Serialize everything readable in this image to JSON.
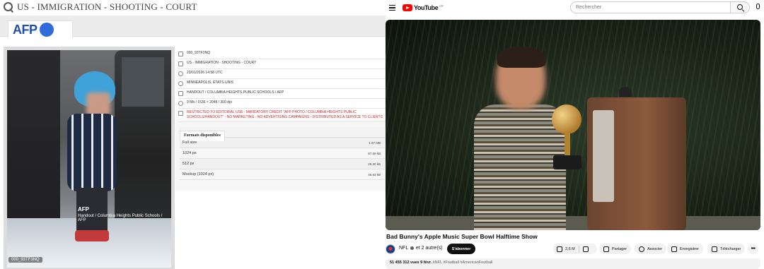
{
  "afp": {
    "search_query": "US - IMMIGRATION - SHOOTING - COURT",
    "logo_text": "AFP",
    "photo": {
      "watermark_logo": "AFP",
      "watermark_credit": "Handout / Columbia Heights Public Schools / AFP",
      "id_label": "000_93TF3NQ"
    },
    "metadata": [
      {
        "icon": "file-icon",
        "text": "000_93TF3NQ"
      },
      {
        "icon": "caption-icon",
        "text": "US - IMMIGRATION - SHOOTING - COURT"
      },
      {
        "icon": "clock-icon",
        "text": "23/01/2026 14:58 UTC"
      },
      {
        "icon": "globe-icon",
        "text": "MINNEAPOLIS, ÉTATS-UNIS"
      },
      {
        "icon": "credit-icon",
        "text": "HANDOUT / COLUMBIA HEIGHTS PUBLIC SCHOOLS / AFP"
      },
      {
        "icon": "size-icon",
        "text": "9 Mb / 1536 × 2048 / 300 dpi"
      },
      {
        "icon": "warning-icon",
        "text": "RESTRICTED TO EDITORIAL USE - MANDATORY CREDIT \"AFP PHOTO / COLUMBIA HEIGHTS PUBLIC SCHOOLS/HANDOUT\" - NO MARKETING - NO ADVERTISING CAMPAIGNS - DISTRIBUTED AS A SERVICE TO CLIENTS"
      }
    ],
    "formats_tab": "Formats disponibles",
    "formats": [
      {
        "name": "Full size",
        "size": "1.97 MB"
      },
      {
        "name": "1024 px",
        "size": "87.69 kB"
      },
      {
        "name": "512 px",
        "size": "29.30 kB"
      },
      {
        "name": "Mockup (1024 px)",
        "size": "46.83 kB"
      }
    ]
  },
  "youtube": {
    "logo_text": "YouTube",
    "country_code": "FR",
    "search_placeholder": "Rechercher",
    "video_title": "Bad Bunny's Apple Music Super Bowl Halftime Show",
    "channel_name": "NFL",
    "channel_others": "et 2 autre(s)",
    "subscribe_label": "S'abonner",
    "like_count": "2,6 M",
    "share_label": "Partager",
    "associate_label": "Associer",
    "save_label": "Enregistrer",
    "download_label": "Télécharger",
    "more_label": "•••",
    "views": "51 455 312 vues",
    "date": "9 févr.",
    "tags": "#NFL #Football #AmericanFootball"
  },
  "colors": {
    "afp_blue": "#2f6bd9",
    "yt_red": "#ff0000",
    "restriction_red": "#c0272d"
  }
}
